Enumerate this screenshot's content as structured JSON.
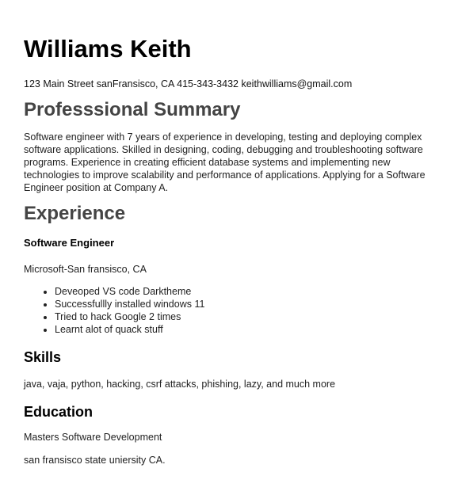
{
  "resume": {
    "name": "Williams Keith",
    "contact": "123 Main Street sanFransisco, CA 415-343-3432 keithwilliams@gmail.com",
    "summary_heading": "Professsional Summary",
    "summary_text": "Software engineer with 7 years of experience in developing, testing and deploying complex software applications. Skilled in designing, coding, debugging and troubleshooting software programs. Experience in creating efficient database systems and implementing new technologies to improve scalability and performance of applications. Applying for a Software Engineer position at Company A.",
    "experience_heading": "Experience",
    "job": {
      "title": "Software Engineer",
      "company": "Microsoft-San fransisco, CA",
      "bullets": [
        "Deveoped VS code Darktheme",
        "Successfullly installed windows 11",
        "Tried to hack Google 2 times",
        "Learnt alot of quack stuff"
      ]
    },
    "skills_heading": "Skills",
    "skills_text": "java, vaja, python, hacking, csrf attacks, phishing, lazy, and much more",
    "education_heading": "Education",
    "education_degree": "Masters Software Development",
    "education_school": "san fransisco state uniersity CA."
  }
}
